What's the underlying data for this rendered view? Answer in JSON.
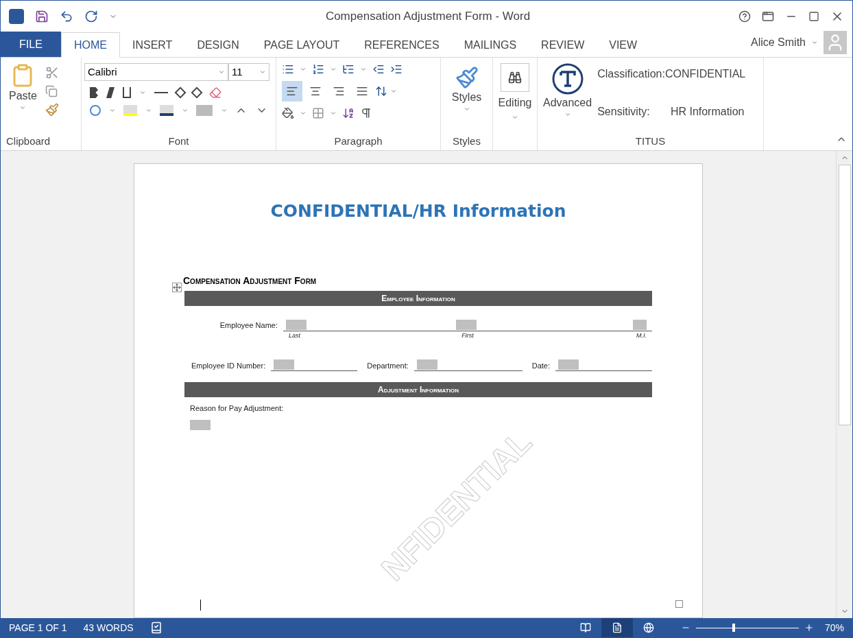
{
  "window": {
    "title": "Compensation Adjustment Form - Word"
  },
  "tabs": [
    {
      "label": "FILE",
      "kind": "file",
      "selected": false
    },
    {
      "label": "HOME",
      "kind": "tab",
      "selected": true
    },
    {
      "label": "INSERT",
      "kind": "tab",
      "selected": false
    },
    {
      "label": "DESIGN",
      "kind": "tab",
      "selected": false
    },
    {
      "label": "PAGE LAYOUT",
      "kind": "tab",
      "selected": false
    },
    {
      "label": "REFERENCES",
      "kind": "tab",
      "selected": false
    },
    {
      "label": "MAILINGS",
      "kind": "tab",
      "selected": false
    },
    {
      "label": "REVIEW",
      "kind": "tab",
      "selected": false
    },
    {
      "label": "VIEW",
      "kind": "tab",
      "selected": false
    }
  ],
  "user": {
    "name": "Alice Smith"
  },
  "ribbon": {
    "clipboard": {
      "label": "Clipboard",
      "paste": "Paste"
    },
    "font": {
      "label": "Font",
      "font_name": "Calibri",
      "font_size": "11"
    },
    "paragraph": {
      "label": "Paragraph",
      "alignments": [
        {
          "selected": true
        },
        {
          "selected": false
        },
        {
          "selected": false
        },
        {
          "selected": false
        }
      ]
    },
    "styles": {
      "label": "Styles",
      "button": "Styles"
    },
    "editing": {
      "button": "Editing"
    },
    "titus": {
      "label": "TITUS",
      "button": "Advanced",
      "classification_label": "Classification:",
      "classification_value": "CONFIDENTIAL",
      "sensitivity_label": "Sensitivity:",
      "sensitivity_value": "HR Information"
    }
  },
  "document": {
    "heading": "CONFIDENTIAL/HR Information",
    "form_title": "Compensation Adjustment Form",
    "employee_section": "Employee Information",
    "name_label": "Employee Name:",
    "name_parts": [
      "Last",
      "First",
      "M.I."
    ],
    "id_label": "Employee ID Number:",
    "department_label": "Department:",
    "date_label": "Date:",
    "adjustment_section": "Adjustment Information",
    "reason_label": "Reason for Pay Adjustment:",
    "watermark": "NFIDENTIAL"
  },
  "status_bar": {
    "page": "PAGE 1 OF 1",
    "words": "43 WORDS",
    "views": [
      {
        "selected": false
      },
      {
        "selected": true
      },
      {
        "selected": false
      }
    ],
    "zoom": {
      "level": 0.37,
      "reading": "70%"
    }
  }
}
